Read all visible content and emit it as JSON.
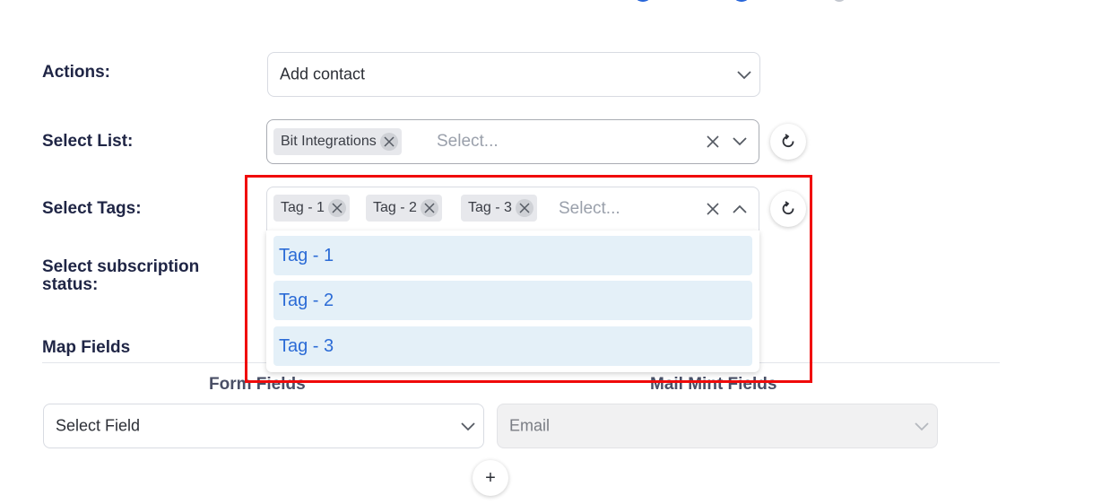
{
  "actions": {
    "label": "Actions:",
    "value": "Add contact"
  },
  "select_list": {
    "label": "Select List:",
    "chips": [
      "Bit Integrations"
    ],
    "placeholder": "Select..."
  },
  "select_tags": {
    "label": "Select Tags:",
    "chips": [
      "Tag - 1",
      "Tag - 2",
      "Tag - 3"
    ],
    "placeholder": "Select...",
    "options": [
      "Tag - 1",
      "Tag - 2",
      "Tag - 3"
    ]
  },
  "subscription": {
    "label_line1": "Select subscription",
    "label_line2": "status:"
  },
  "map_fields": {
    "title": "Map Fields",
    "form_fields_header": "Form Fields",
    "mail_mint_fields_header": "Mail Mint Fields",
    "form_field_value": "Select Field",
    "mail_mint_value": "Email",
    "add_label": "+"
  },
  "colors": {
    "accent": "#2b6bd6",
    "option_bg": "#e4f0f8",
    "highlight": "#f00a0a",
    "label": "#1f2545"
  },
  "icons": {
    "chevron": "chevron-down-icon",
    "chevron_up": "chevron-up-icon",
    "clear": "close-icon",
    "refresh": "refresh-icon"
  }
}
